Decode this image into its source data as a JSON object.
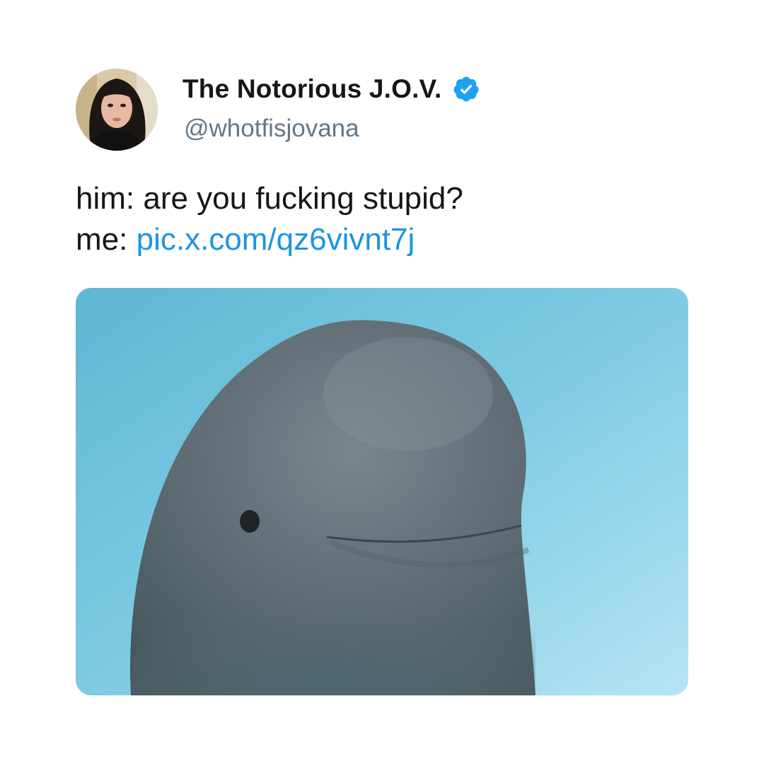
{
  "tweet": {
    "author": {
      "display_name": "The Notorious J.O.V.",
      "handle": "@whotfisjovana",
      "verified": true,
      "avatar_icon": "profile-photo"
    },
    "text": {
      "line1": "him: are you fucking stupid?",
      "line2_prefix": "me:",
      "link": "pic.x.com/qz6vivnt7j"
    },
    "media": {
      "subject": "beluga-whale-photo"
    }
  },
  "colors": {
    "name": "#14171a",
    "handle": "#657786",
    "link": "#1b95e0",
    "verified_badge": "#1da1f2",
    "water": "#7cc8e2"
  }
}
